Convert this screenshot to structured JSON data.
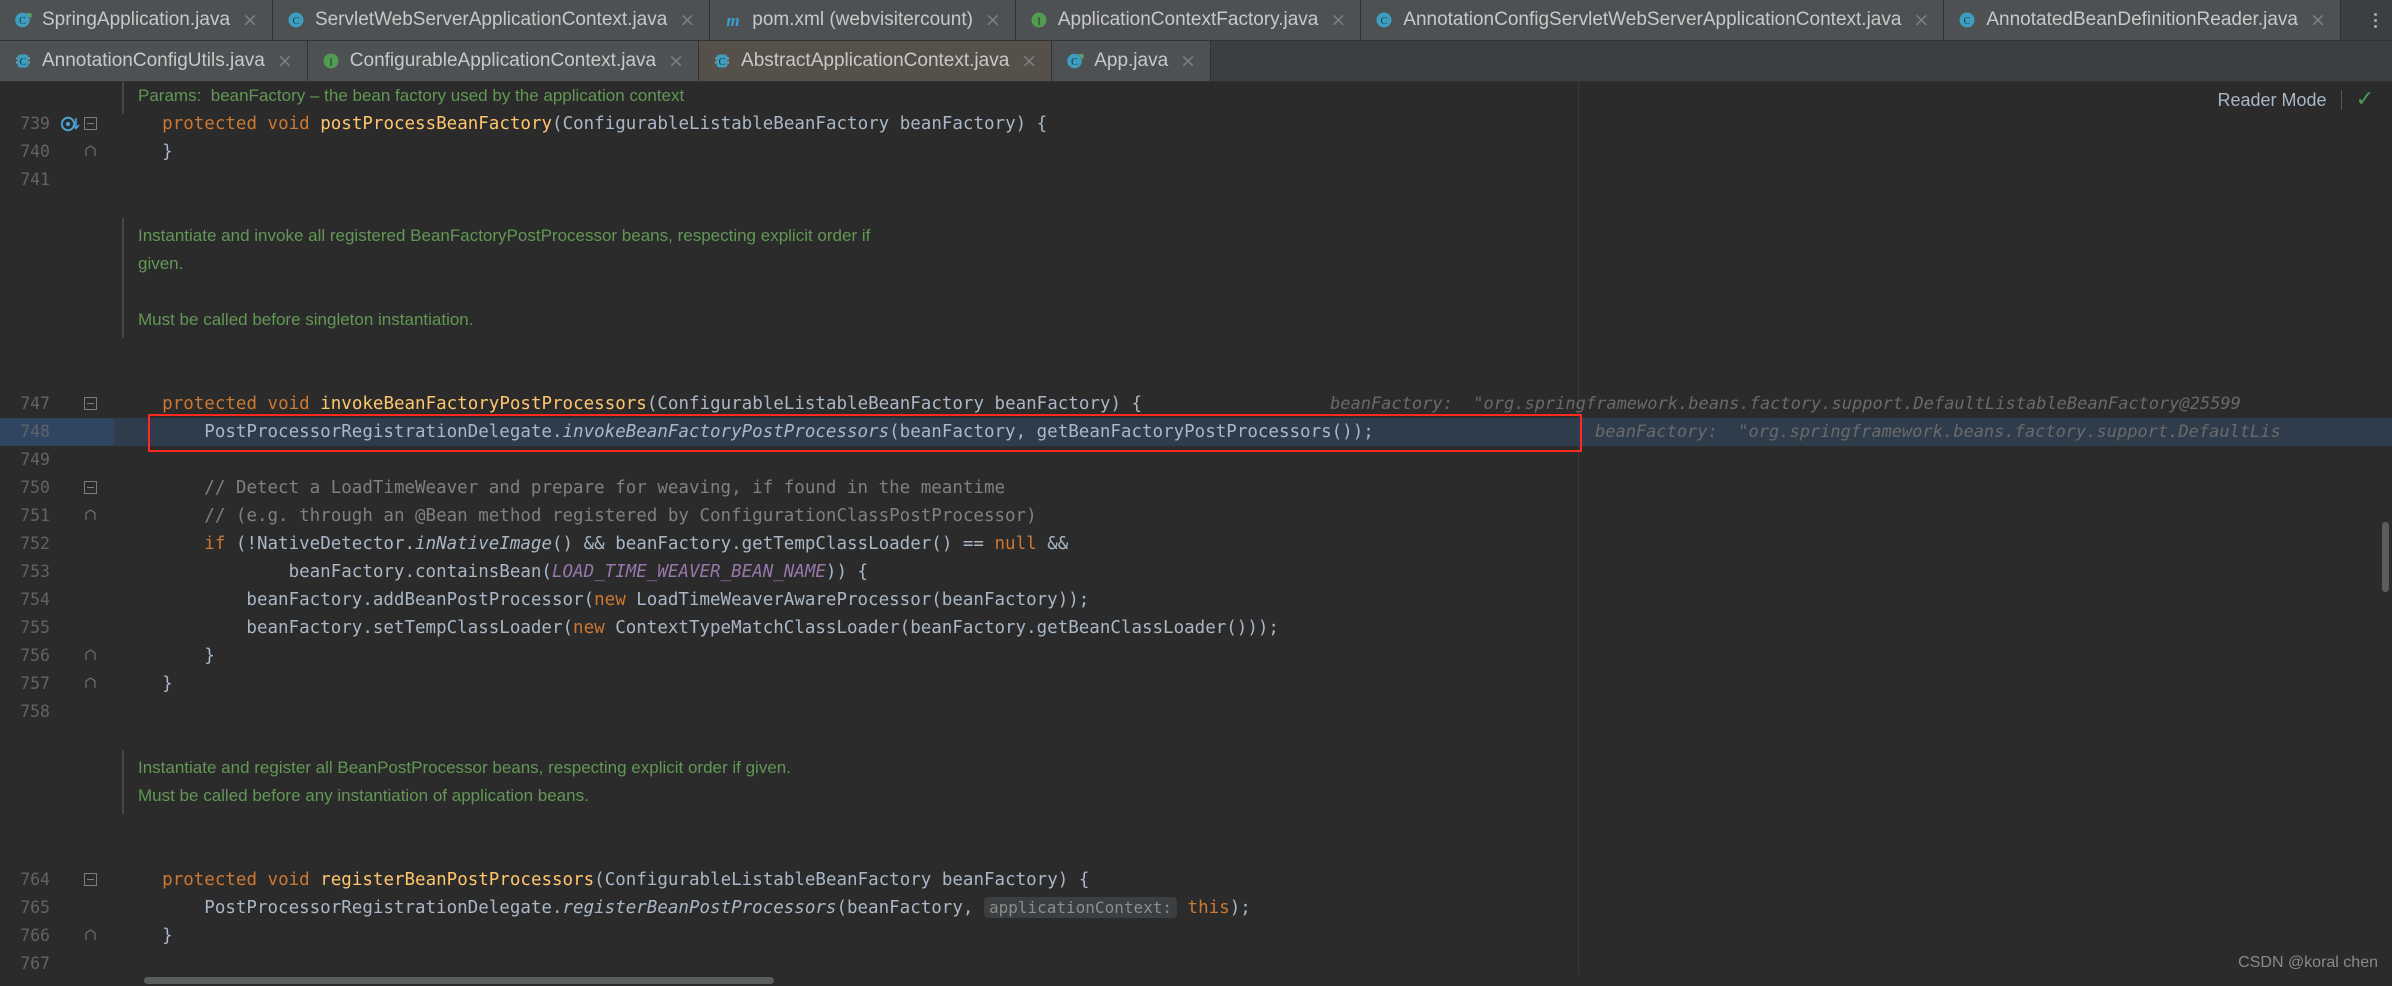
{
  "tabs_row1": [
    {
      "label": "SpringApplication.java",
      "icon": "java-class-run-icon",
      "icon_kind": "class-run",
      "closeable": true,
      "active": false
    },
    {
      "label": "ServletWebServerApplicationContext.java",
      "icon": "java-class-icon",
      "icon_kind": "class",
      "closeable": true,
      "active": false
    },
    {
      "label": "pom.xml (webvisitercount)",
      "icon": "maven-icon",
      "icon_kind": "maven",
      "closeable": true,
      "active": false
    },
    {
      "label": "ApplicationContextFactory.java",
      "icon": "java-interface-icon",
      "icon_kind": "interface",
      "closeable": true,
      "active": false
    },
    {
      "label": "AnnotationConfigServletWebServerApplicationContext.java",
      "icon": "java-class-icon",
      "icon_kind": "class",
      "closeable": true,
      "active": false
    },
    {
      "label": "AnnotatedBeanDefinitionReader.java",
      "icon": "java-class-icon",
      "icon_kind": "class",
      "closeable": true,
      "active": false
    }
  ],
  "tabs_row2": [
    {
      "label": "AnnotationConfigUtils.java",
      "icon": "java-abstract-class-icon",
      "icon_kind": "abstract",
      "closeable": true,
      "active": false
    },
    {
      "label": "ConfigurableApplicationContext.java",
      "icon": "java-interface-icon",
      "icon_kind": "interface",
      "closeable": true,
      "active": false
    },
    {
      "label": "AbstractApplicationContext.java",
      "icon": "java-abstract-class-icon",
      "icon_kind": "abstract",
      "closeable": true,
      "active": true
    },
    {
      "label": "App.java",
      "icon": "java-class-run-icon",
      "icon_kind": "class-run",
      "closeable": true,
      "active": false
    }
  ],
  "overflow_menu": "tab-overflow-menu",
  "reader_mode": {
    "label": "Reader Mode",
    "check_glyph": "✓"
  },
  "colors": {
    "editor_bg": "#2b2b2b",
    "tab_bg": "#4e5153",
    "active_tab_bg": "#55504a",
    "keyword": "#cc7832",
    "method": "#ffc66d",
    "identifier": "#a9b7c6",
    "javadoc": "#629755",
    "comment": "#808080",
    "constant": "#9876aa",
    "hint_bg": "#3b3f41",
    "hint_fg": "#8c8c8c",
    "highlight_line_bg": "#2f3c4b",
    "redbox_border": "#ff2a1f",
    "check_green": "#499c54"
  },
  "lines": [
    {
      "num": "",
      "kind": "doc",
      "segments": [
        {
          "t": "Params:  beanFactory – the bean factory used by the application context",
          "c": "doc"
        }
      ]
    },
    {
      "num": "739",
      "kind": "code",
      "fold": "collapse",
      "breakpoint": "run-to-cursor-icon",
      "segments": [
        {
          "t": "    ",
          "c": "txt"
        },
        {
          "t": "protected",
          "c": "kw"
        },
        {
          "t": " ",
          "c": "txt"
        },
        {
          "t": "void",
          "c": "kw"
        },
        {
          "t": " ",
          "c": "txt"
        },
        {
          "t": "postProcessBeanFactory",
          "c": "mth"
        },
        {
          "t": "(ConfigurableListableBeanFactory beanFactory) {",
          "c": "typ"
        }
      ]
    },
    {
      "num": "740",
      "kind": "code",
      "fold": "end",
      "segments": [
        {
          "t": "    }",
          "c": "txt"
        }
      ]
    },
    {
      "num": "741",
      "kind": "code",
      "segments": []
    },
    {
      "num": "",
      "kind": "blank",
      "segments": []
    },
    {
      "num": "",
      "kind": "doc",
      "segments": [
        {
          "t": "Instantiate and invoke all registered BeanFactoryPostProcessor beans, respecting explicit order if",
          "c": "doc"
        }
      ]
    },
    {
      "num": "",
      "kind": "doc",
      "segments": [
        {
          "t": "given.",
          "c": "doc"
        }
      ]
    },
    {
      "num": "",
      "kind": "docblank",
      "segments": []
    },
    {
      "num": "",
      "kind": "doc",
      "segments": [
        {
          "t": "Must be called before singleton instantiation.",
          "c": "doc"
        }
      ]
    },
    {
      "num": "",
      "kind": "blank",
      "segments": []
    },
    {
      "num": "",
      "kind": "blank",
      "segments": []
    },
    {
      "num": "747",
      "kind": "code",
      "fold": "collapse",
      "segments": [
        {
          "t": "    ",
          "c": "txt"
        },
        {
          "t": "protected",
          "c": "kw"
        },
        {
          "t": " ",
          "c": "txt"
        },
        {
          "t": "void",
          "c": "kw"
        },
        {
          "t": " ",
          "c": "txt"
        },
        {
          "t": "invokeBeanFactoryPostProcessors",
          "c": "mth"
        },
        {
          "t": "(ConfigurableListableBeanFactory beanFactory) {",
          "c": "typ"
        }
      ],
      "valhint": "beanFactory:  \"org.springframework.beans.factory.support.DefaultListableBeanFactory@25599"
    },
    {
      "num": "748",
      "kind": "code",
      "highlighted": true,
      "redbox": true,
      "segments": [
        {
          "t": "        PostProcessorRegistrationDelegate.",
          "c": "txt"
        },
        {
          "t": "invokeBeanFactoryPostProcessors",
          "c": "stat"
        },
        {
          "t": "(beanFactory, getBeanFactoryPostProcessors());",
          "c": "txt"
        }
      ],
      "valhint": "beanFactory:  \"org.springframework.beans.factory.support.DefaultLis"
    },
    {
      "num": "749",
      "kind": "code",
      "segments": []
    },
    {
      "num": "750",
      "kind": "code",
      "fold": "collapse",
      "segments": [
        {
          "t": "        ",
          "c": "txt"
        },
        {
          "t": "// Detect a LoadTimeWeaver and prepare for weaving, if found in the meantime",
          "c": "cmt"
        }
      ]
    },
    {
      "num": "751",
      "kind": "code",
      "fold": "end",
      "segments": [
        {
          "t": "        ",
          "c": "txt"
        },
        {
          "t": "// (e.g. through an @Bean method registered by ConfigurationClassPostProcessor)",
          "c": "cmt"
        }
      ]
    },
    {
      "num": "752",
      "kind": "code",
      "segments": [
        {
          "t": "        ",
          "c": "txt"
        },
        {
          "t": "if",
          "c": "kw"
        },
        {
          "t": " (!NativeDetector.",
          "c": "txt"
        },
        {
          "t": "inNativeImage",
          "c": "stat"
        },
        {
          "t": "() && beanFactory.getTempClassLoader() == ",
          "c": "txt"
        },
        {
          "t": "null",
          "c": "kw"
        },
        {
          "t": " &&",
          "c": "txt"
        }
      ]
    },
    {
      "num": "753",
      "kind": "code",
      "segments": [
        {
          "t": "                beanFactory.containsBean(",
          "c": "txt"
        },
        {
          "t": "LOAD_TIME_WEAVER_BEAN_NAME",
          "c": "cst"
        },
        {
          "t": ")) {",
          "c": "txt"
        }
      ]
    },
    {
      "num": "754",
      "kind": "code",
      "segments": [
        {
          "t": "            beanFactory.addBeanPostProcessor(",
          "c": "txt"
        },
        {
          "t": "new",
          "c": "kw"
        },
        {
          "t": " LoadTimeWeaverAwareProcessor(beanFactory));",
          "c": "txt"
        }
      ]
    },
    {
      "num": "755",
      "kind": "code",
      "segments": [
        {
          "t": "            beanFactory.setTempClassLoader(",
          "c": "txt"
        },
        {
          "t": "new",
          "c": "kw"
        },
        {
          "t": " ContextTypeMatchClassLoader(beanFactory.getBeanClassLoader()));",
          "c": "txt"
        }
      ]
    },
    {
      "num": "756",
      "kind": "code",
      "fold": "end",
      "segments": [
        {
          "t": "        }",
          "c": "txt"
        }
      ]
    },
    {
      "num": "757",
      "kind": "code",
      "fold": "end",
      "segments": [
        {
          "t": "    }",
          "c": "txt"
        }
      ]
    },
    {
      "num": "758",
      "kind": "code",
      "segments": []
    },
    {
      "num": "",
      "kind": "blank",
      "segments": []
    },
    {
      "num": "",
      "kind": "doc",
      "segments": [
        {
          "t": "Instantiate and register all BeanPostProcessor beans, respecting explicit order if given.",
          "c": "doc"
        }
      ]
    },
    {
      "num": "",
      "kind": "doc",
      "segments": [
        {
          "t": "Must be called before any instantiation of application beans.",
          "c": "doc"
        }
      ]
    },
    {
      "num": "",
      "kind": "blank",
      "segments": []
    },
    {
      "num": "",
      "kind": "blank",
      "segments": []
    },
    {
      "num": "764",
      "kind": "code",
      "fold": "collapse",
      "segments": [
        {
          "t": "    ",
          "c": "txt"
        },
        {
          "t": "protected",
          "c": "kw"
        },
        {
          "t": " ",
          "c": "txt"
        },
        {
          "t": "void",
          "c": "kw"
        },
        {
          "t": " ",
          "c": "txt"
        },
        {
          "t": "registerBeanPostProcessors",
          "c": "mth"
        },
        {
          "t": "(ConfigurableListableBeanFactory beanFactory) {",
          "c": "typ"
        }
      ]
    },
    {
      "num": "765",
      "kind": "code",
      "segments": [
        {
          "t": "        PostProcessorRegistrationDelegate.",
          "c": "txt"
        },
        {
          "t": "registerBeanPostProcessors",
          "c": "stat"
        },
        {
          "t": "(beanFactory, ",
          "c": "txt"
        },
        {
          "t": "HINT:applicationContext:",
          "c": "hint"
        },
        {
          "t": " ",
          "c": "txt"
        },
        {
          "t": "this",
          "c": "kw"
        },
        {
          "t": ");",
          "c": "txt"
        }
      ]
    },
    {
      "num": "766",
      "kind": "code",
      "fold": "end",
      "segments": [
        {
          "t": "    }",
          "c": "txt"
        }
      ]
    },
    {
      "num": "767",
      "kind": "code",
      "segments": []
    }
  ],
  "watermark": "CSDN @koral chen"
}
